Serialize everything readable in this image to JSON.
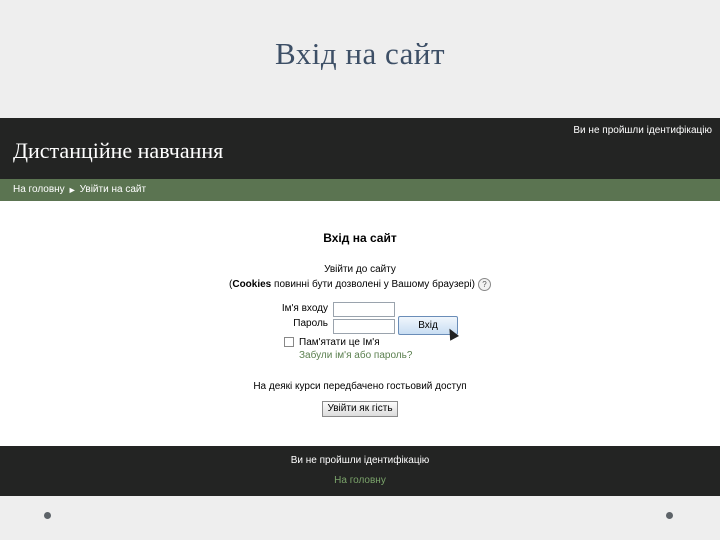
{
  "slide": {
    "title": "Вхід на сайт"
  },
  "header": {
    "site_title": "Дистанційне навчання",
    "login_info": "Ви не пройшли ідентифікацію"
  },
  "breadcrumb": {
    "home": "На головну",
    "separator": "►",
    "current": "Увійти на сайт"
  },
  "login": {
    "heading": "Вхід на сайт",
    "intro_line1": "Увійти до сайту",
    "intro_line2_open": "(",
    "intro_line2_bold": "Cookies",
    "intro_line2_rest": " повинні бути дозволені у Вашому браузері)",
    "help_icon": "?",
    "username_label": "Ім'я входу",
    "password_label": "Пароль",
    "username_value": "",
    "password_value": "",
    "login_button": "Вхід",
    "remember_label": "Пам'ятати це Ім'я",
    "forgot_link": "Забули ім'я або пароль?"
  },
  "guest": {
    "text": "На деякі курси передбачено гостьовий доступ",
    "button": "Увійти як гість"
  },
  "footer": {
    "login_info": "Ви не пройшли ідентифікацію",
    "home_link": "На головну"
  },
  "colors": {
    "header_bg": "#232423",
    "navbar_bg": "#5b7451",
    "link": "#5a7f4e",
    "title": "#3d4f66"
  }
}
